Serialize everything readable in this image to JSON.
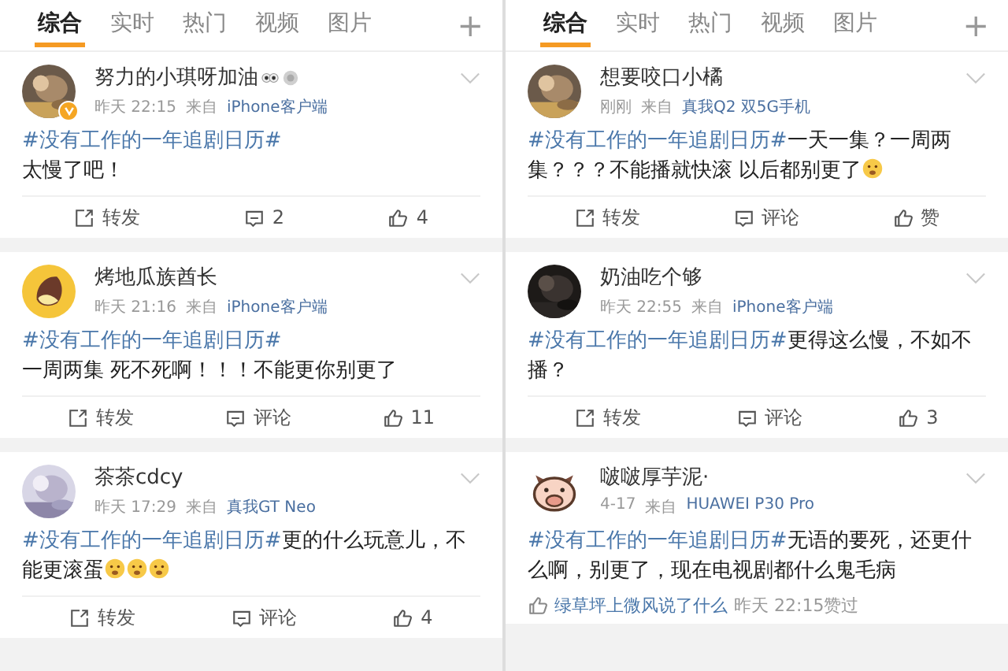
{
  "panels": [
    {
      "tabs": [
        {
          "label": "综合",
          "selected": true
        },
        {
          "label": "实时",
          "selected": false
        },
        {
          "label": "热门",
          "selected": false
        },
        {
          "label": "视频",
          "selected": false
        },
        {
          "label": "图片",
          "selected": false
        }
      ],
      "add_tab": "+",
      "posts": [
        {
          "name": "努力的小琪呀加油",
          "name_emojis": [
            {
              "kind": "eyes"
            },
            {
              "kind": "badge"
            }
          ],
          "avatar": {
            "kind": "picture"
          },
          "verified": true,
          "time": "昨天 22:15",
          "from": "来自",
          "source": "iPhone客户端",
          "topic": "#没有工作的一年追剧日历#",
          "break_after_topic": true,
          "text": "太慢了吧！",
          "actions": [
            {
              "kind": "repost",
              "label": "转发"
            },
            {
              "kind": "comment",
              "label": "2"
            },
            {
              "kind": "like",
              "label": "4"
            }
          ]
        },
        {
          "name": "烤地瓜族酋长",
          "avatar": {
            "kind": "sweet-potato"
          },
          "verified": false,
          "time": "昨天 21:16",
          "from": "来自",
          "source": "iPhone客户端",
          "topic": "#没有工作的一年追剧日历#",
          "break_after_topic": true,
          "text": "一周两集 死不死啊！！！不能更你别更了",
          "actions": [
            {
              "kind": "repost",
              "label": "转发"
            },
            {
              "kind": "comment",
              "label": "评论"
            },
            {
              "kind": "like",
              "label": "11"
            }
          ]
        },
        {
          "name": "茶茶cdcy",
          "avatar": {
            "kind": "picture"
          },
          "verified": false,
          "time": "昨天 17:29",
          "from": "来自",
          "source": "真我GT Neo",
          "topic": "#没有工作的一年追剧日历#",
          "break_after_topic": false,
          "text": "更的什么玩意儿，不能更滚蛋",
          "emojis": [
            {
              "kind": "fearful"
            },
            {
              "kind": "fearful"
            },
            {
              "kind": "fearful"
            }
          ],
          "actions": [
            {
              "kind": "repost",
              "label": "转发"
            },
            {
              "kind": "comment",
              "label": "评论"
            },
            {
              "kind": "like",
              "label": "4"
            }
          ]
        }
      ]
    },
    {
      "tabs": [
        {
          "label": "综合",
          "selected": true
        },
        {
          "label": "实时",
          "selected": false
        },
        {
          "label": "热门",
          "selected": false
        },
        {
          "label": "视频",
          "selected": false
        },
        {
          "label": "图片",
          "selected": false
        }
      ],
      "add_tab": "+",
      "posts": [
        {
          "name": "想要咬口小橘",
          "avatar": {
            "kind": "picture"
          },
          "verified": false,
          "time": "刚刚",
          "from": "来自",
          "source": "真我Q2 双5G手机",
          "topic": "#没有工作的一年追剧日历#",
          "break_after_topic": false,
          "text": "一天一集？一周两集？？？不能播就快滚 以后都别更了",
          "emojis": [
            {
              "kind": "fearful"
            }
          ],
          "actions": [
            {
              "kind": "repost",
              "label": "转发"
            },
            {
              "kind": "comment",
              "label": "评论"
            },
            {
              "kind": "like",
              "label": "赞"
            }
          ]
        },
        {
          "name": "奶油吃个够",
          "avatar": {
            "kind": "picture"
          },
          "verified": false,
          "time": "昨天 22:55",
          "from": "来自",
          "source": "iPhone客户端",
          "topic": "#没有工作的一年追剧日历#",
          "break_after_topic": false,
          "text": "更得这么慢，不如不播？",
          "actions": [
            {
              "kind": "repost",
              "label": "转发"
            },
            {
              "kind": "comment",
              "label": "评论"
            },
            {
              "kind": "like",
              "label": "3"
            }
          ]
        },
        {
          "name": "啵啵厚芋泥·",
          "avatar": {
            "kind": "pig"
          },
          "verified": false,
          "time": "4-17",
          "from": "来自",
          "source": "HUAWEI P30 Pro",
          "topic": "#没有工作的一年追剧日历#",
          "break_after_topic": false,
          "text": "无语的要死，还更什么啊，别更了，现在电视剧都什么鬼毛病",
          "liked_by": {
            "user": "绿草坪上微风说了什么",
            "time": "昨天 22:15赞过"
          }
        }
      ]
    }
  ]
}
